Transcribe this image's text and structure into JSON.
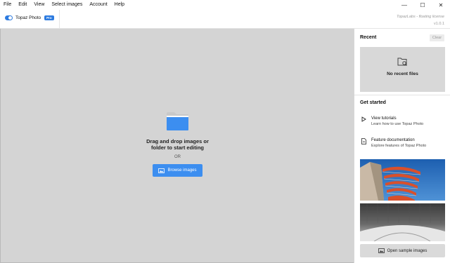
{
  "menu": [
    "File",
    "Edit",
    "View",
    "Select images",
    "Account",
    "Help"
  ],
  "window_controls": {
    "minimize": "—",
    "maximize": "☐",
    "close": "✕"
  },
  "header": {
    "app_name": "Topaz Photo",
    "badge": "Pro",
    "license_line": "TopazLabs - floating license",
    "version": "v1.0.1"
  },
  "drop_zone": {
    "title_line1": "Drag and drop images or",
    "title_line2": "folder to start editing",
    "or_text": "OR",
    "browse_label": "Browse images"
  },
  "sidebar": {
    "recent_title": "Recent",
    "clear_label": "Clear",
    "recent_empty": "No recent files",
    "get_started_title": "Get started",
    "items": [
      {
        "title": "View tutorials",
        "subtitle": "Learn how to use Topaz Photo",
        "icon": "play-icon"
      },
      {
        "title": "Feature documentation",
        "subtitle": "Explore features of Topaz Photo",
        "icon": "document-icon"
      }
    ],
    "open_sample_label": "Open sample images"
  },
  "colors": {
    "accent": "#3c8ef0",
    "main_bg": "#d4d4d4"
  }
}
